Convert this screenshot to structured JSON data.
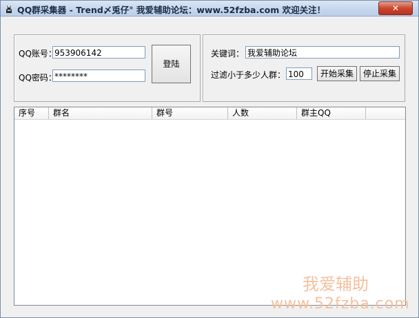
{
  "window": {
    "title": "QQ群采集器 - Trend〆兎仔° 我爱辅助论坛：www.52fzba.com 欢迎关注！",
    "close_label": "✕",
    "app_icon": "rabbit-icon"
  },
  "login": {
    "account_label": "QQ账号：",
    "account_value": "953906142",
    "password_label": "QQ密码：",
    "password_value": "********",
    "login_button": "登陆"
  },
  "collect": {
    "keyword_label": "关键词：",
    "keyword_value": "我爱辅助论坛",
    "filter_label": "过滤小于多少人群：",
    "filter_value": "100",
    "start_button": "开始采集",
    "stop_button": "停止采集"
  },
  "results": {
    "columns": [
      "序号",
      "群名",
      "群号",
      "人数",
      "群主QQ"
    ]
  },
  "watermark": {
    "line1": "我爱辅助",
    "line2": "www.52fzba.com"
  }
}
